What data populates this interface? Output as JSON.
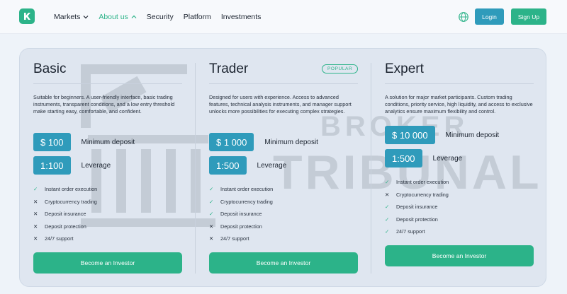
{
  "header": {
    "logo_letter": "K",
    "nav": [
      {
        "label": "Markets",
        "has_dropdown": true,
        "active": false
      },
      {
        "label": "About us",
        "has_dropdown": true,
        "active": true
      },
      {
        "label": "Security",
        "has_dropdown": false,
        "active": false
      },
      {
        "label": "Platform",
        "has_dropdown": false,
        "active": false
      },
      {
        "label": "Investments",
        "has_dropdown": false,
        "active": false
      }
    ],
    "login_label": "Login",
    "signup_label": "Sign Up"
  },
  "watermark": {
    "line1": "BROKER",
    "line2": "TRIBUNAL"
  },
  "plans": [
    {
      "title": "Basic",
      "description": "Suitable for beginners. A user-friendly interface, basic trading instruments, transparent conditions, and a low entry threshold make starting easy, comfortable, and confident.",
      "deposit_value": "$ 100",
      "deposit_label": "Minimum deposit",
      "leverage_value": "1:100",
      "leverage_label": "Leverage",
      "features": [
        {
          "label": "Instant order execution",
          "included": true
        },
        {
          "label": "Cryptocurrency trading",
          "included": false
        },
        {
          "label": "Deposit insurance",
          "included": false
        },
        {
          "label": "Deposit protection",
          "included": false
        },
        {
          "label": "24/7 support",
          "included": false
        }
      ],
      "cta": "Become an Investor"
    },
    {
      "title": "Trader",
      "badge": "POPULAR",
      "description": "Designed for users with experience. Access to advanced features, technical analysis instruments, and manager support unlocks more possibilities for executing complex strategies.",
      "deposit_value": "$ 1 000",
      "deposit_label": "Minimum deposit",
      "leverage_value": "1:500",
      "leverage_label": "Leverage",
      "features": [
        {
          "label": "Instant order execution",
          "included": true
        },
        {
          "label": "Cryptocurrency trading",
          "included": true
        },
        {
          "label": "Deposit insurance",
          "included": true
        },
        {
          "label": "Deposit protection",
          "included": false
        },
        {
          "label": "24/7 support",
          "included": false
        }
      ],
      "cta": "Become an Investor"
    },
    {
      "title": "Expert",
      "description": "A solution for major market participants. Custom trading conditions, priority service, high liquidity, and access to exclusive analytics ensure maximum flexibility and control.",
      "deposit_value": "$ 10 000",
      "deposit_label": "Minimum deposit",
      "leverage_value": "1:500",
      "leverage_label": "Leverage",
      "features": [
        {
          "label": "Instant order execution",
          "included": true
        },
        {
          "label": "Cryptocurrency trading",
          "included": false
        },
        {
          "label": "Deposit insurance",
          "included": true
        },
        {
          "label": "Deposit protection",
          "included": true
        },
        {
          "label": "24/7 support",
          "included": true
        }
      ],
      "cta": "Become an Investor"
    }
  ],
  "colors": {
    "accent_green": "#2cb389",
    "accent_blue": "#2f9bbb",
    "panel_bg": "#dfe6f0"
  }
}
